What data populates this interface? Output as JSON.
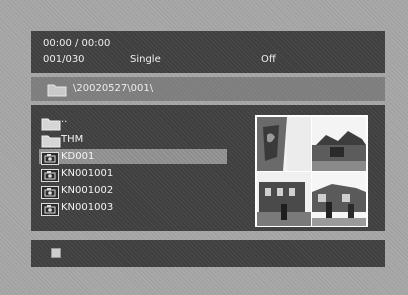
{
  "status": {
    "time": "00:00  /  00:00",
    "track": "001/030",
    "mode": "Single",
    "repeat": "Off"
  },
  "path": {
    "text": "\\20020527\\001\\"
  },
  "file_list": [
    {
      "label": "..",
      "icon": "folder-up-icon"
    },
    {
      "label": "THM",
      "icon": "folder-icon"
    },
    {
      "label": "KD001",
      "icon": "camera-icon",
      "selected": true
    },
    {
      "label": "KN001001",
      "icon": "camera-icon"
    },
    {
      "label": "KN001002",
      "icon": "camera-icon"
    },
    {
      "label": "KN001003",
      "icon": "camera-icon"
    }
  ],
  "thumbnails": [
    "thumbnail-1",
    "thumbnail-2",
    "thumbnail-3",
    "thumbnail-4"
  ],
  "colors": {
    "panel_dark": "#3f3f3f",
    "screen_background": "#a9a9a9",
    "selection": "#8d8d8d",
    "text": "#f4f4f4"
  }
}
